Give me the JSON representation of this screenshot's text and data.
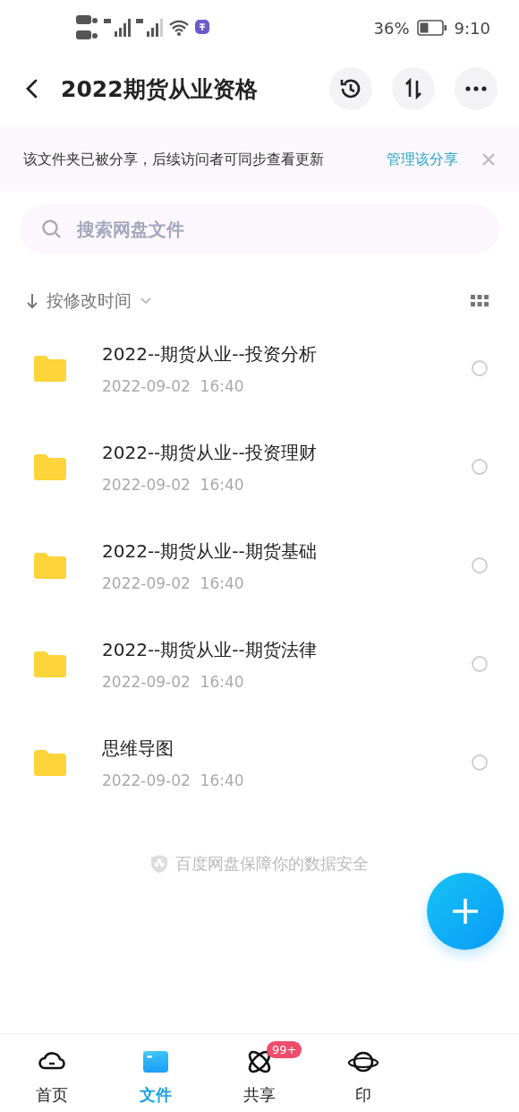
{
  "status_bar": {
    "battery": "36%",
    "time": "9:10"
  },
  "header": {
    "title": "2022期货从业资格"
  },
  "banner": {
    "message": "该文件夹已被分享，后续访问者可同步查看更新",
    "link": "管理该分享"
  },
  "search": {
    "placeholder": "搜索网盘文件"
  },
  "sort": {
    "label": "按修改时间"
  },
  "files": [
    {
      "name": "2022--期货从业--投资分析",
      "date": "2022-09-02  16:40",
      "selected": false
    },
    {
      "name": "2022--期货从业--投资理财",
      "date": "2022-09-02  16:40",
      "selected": false
    },
    {
      "name": "2022--期货从业--期货基础",
      "date": "2022-09-02  16:40",
      "selected": false
    },
    {
      "name": "2022--期货从业--期货法律",
      "date": "2022-09-02  16:40",
      "selected": false
    },
    {
      "name": "思维导图",
      "date": "2022-09-02  16:40",
      "selected": false
    }
  ],
  "footer_note": "百度网盘保障你的数据安全",
  "tabs": [
    {
      "kind": "home",
      "label": "首页",
      "selected": false
    },
    {
      "kind": "files",
      "label": "文件",
      "selected": true
    },
    {
      "kind": "share",
      "label": "共享",
      "badge": "99+",
      "selected": false
    },
    {
      "kind": "planet",
      "label": "印",
      "selected": false
    }
  ]
}
